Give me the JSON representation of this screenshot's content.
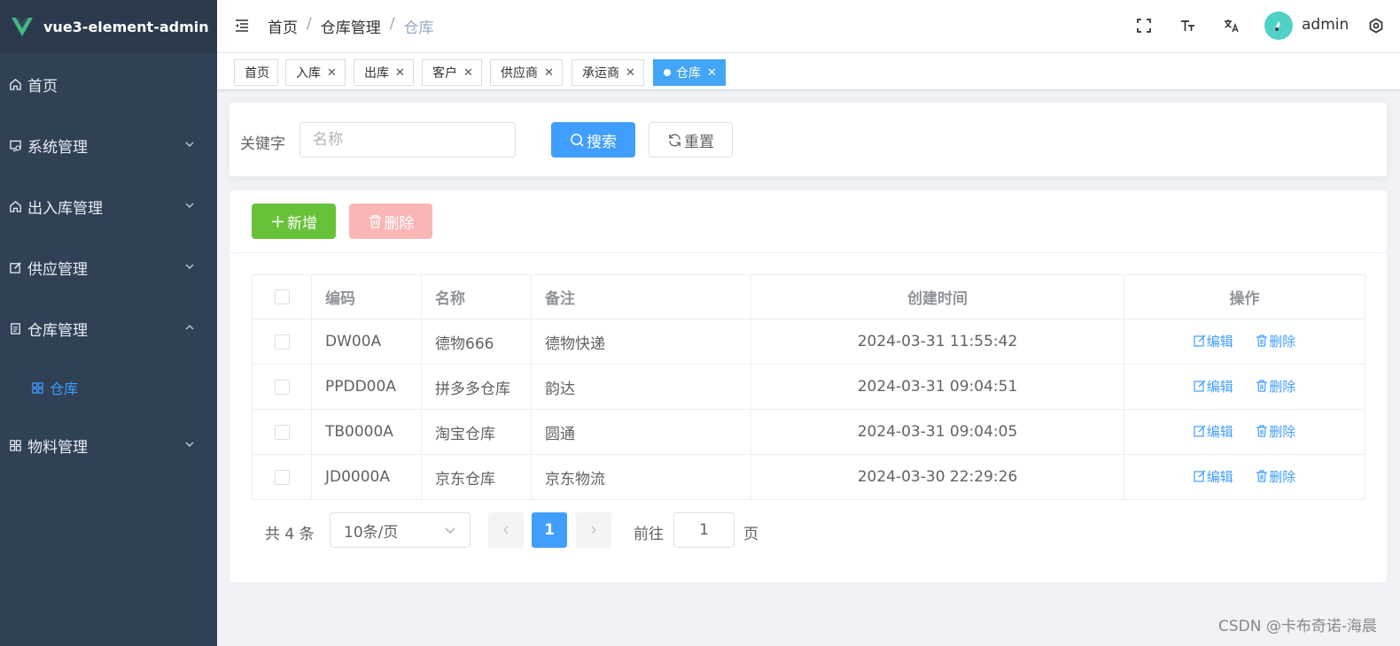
{
  "app": {
    "title": "vue3-element-admin"
  },
  "sidebar": {
    "items": [
      {
        "label": "首页",
        "icon": "home-icon"
      },
      {
        "label": "系统管理",
        "icon": "system-icon"
      },
      {
        "label": "出入库管理",
        "icon": "home-icon"
      },
      {
        "label": "供应管理",
        "icon": "edit-icon"
      },
      {
        "label": "仓库管理",
        "icon": "document-icon"
      },
      {
        "label": "仓库",
        "icon": "grid-icon"
      },
      {
        "label": "物料管理",
        "icon": "grid-icon"
      }
    ]
  },
  "header": {
    "breadcrumb": [
      "首页",
      "仓库管理",
      "仓库"
    ],
    "separator": "/",
    "username": "admin"
  },
  "tags": [
    {
      "label": "首页"
    },
    {
      "label": "入库"
    },
    {
      "label": "出库"
    },
    {
      "label": "客户"
    },
    {
      "label": "供应商"
    },
    {
      "label": "承运商"
    },
    {
      "label": "仓库"
    }
  ],
  "search": {
    "label": "关键字",
    "placeholder": "名称",
    "search_label": "搜索",
    "reset_label": "重置"
  },
  "toolbar": {
    "add_label": "新增",
    "delete_label": "删除"
  },
  "table": {
    "headers": [
      "编码",
      "名称",
      "备注",
      "创建时间",
      "操作"
    ],
    "rows": [
      {
        "code": "DW00A",
        "name": "德物666",
        "note": "德物快递",
        "time": "2024-03-31 11:55:42"
      },
      {
        "code": "PPDD00A",
        "name": "拼多多仓库",
        "note": "韵达",
        "time": "2024-03-31 09:04:51"
      },
      {
        "code": "TB0000A",
        "name": "淘宝仓库",
        "note": "圆通",
        "time": "2024-03-31 09:04:05"
      },
      {
        "code": "JD0000A",
        "name": "京东仓库",
        "note": "京东物流",
        "time": "2024-03-30 22:29:26"
      }
    ],
    "edit_label": "编辑",
    "delete_label": "删除"
  },
  "pagination": {
    "total_text": "共 4 条",
    "page_size": "10条/页",
    "current_page": "1",
    "goto_label": "前往",
    "goto_value": "1",
    "goto_suffix": "页"
  },
  "watermark": "CSDN @卡布奇诺-海晨",
  "colors": {
    "primary": "#409eff",
    "success": "#67c23a",
    "danger_light": "#fab6b6",
    "sidebar": "#304156"
  }
}
